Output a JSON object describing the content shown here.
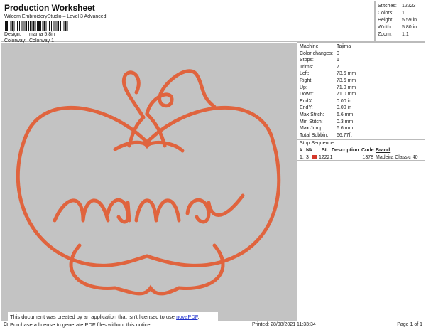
{
  "header": {
    "title": "Production Worksheet",
    "subtitle": "Wilcom EmbroideryStudio – Level 3 Advanced",
    "design_label": "Design:",
    "design_value": "mama 5.8in",
    "colorway_label": "Colorway:",
    "colorway_value": "Colorway 1"
  },
  "stats": [
    {
      "k": "Stitches:",
      "v": "12223"
    },
    {
      "k": "Colors:",
      "v": "1"
    },
    {
      "k": "Height:",
      "v": "5.59 in"
    },
    {
      "k": "Width:",
      "v": "5.80 in"
    },
    {
      "k": "Zoom:",
      "v": "1:1"
    }
  ],
  "machine": [
    {
      "k": "Machine:",
      "v": "Tajima"
    },
    {
      "k": "Color changes:",
      "v": "0"
    },
    {
      "k": "Stops:",
      "v": "1"
    },
    {
      "k": "Trims:",
      "v": "7"
    },
    {
      "k": "Left:",
      "v": "73.6 mm"
    },
    {
      "k": "Right:",
      "v": "73.6 mm"
    },
    {
      "k": "Up:",
      "v": "71.0 mm"
    },
    {
      "k": "Down:",
      "v": "71.0 mm"
    },
    {
      "k": "EndX:",
      "v": "0.00 in"
    },
    {
      "k": "EndY:",
      "v": "0.00 in"
    },
    {
      "k": "Max Stitch:",
      "v": "6.6 mm"
    },
    {
      "k": "Min Stitch:",
      "v": "0.3 mm"
    },
    {
      "k": "Max Jump:",
      "v": "6.6 mm"
    },
    {
      "k": "Total Bobbin:",
      "v": "66.77ft"
    }
  ],
  "stop_sequence": {
    "label": "Stop Sequence:",
    "headers": [
      "#",
      "N#",
      "St.",
      "Description",
      "Code",
      "Brand"
    ],
    "rows": [
      {
        "n": "1.",
        "nn": "3",
        "color": "#d4382a",
        "st": "12221",
        "desc": "",
        "code": "1378",
        "brand": "Madeira Classic 40"
      }
    ]
  },
  "design_color": "#e0643e",
  "footer": {
    "left": "Cr",
    "printed": "Printed: 28/08/2021 11:33:34",
    "page": "Page 1 of 1"
  },
  "notice": {
    "line1": "This document was created by an application that isn't licensed to use ",
    "link": "novaPDF",
    "line1_end": ".",
    "line2": "Purchase a license to generate PDF files without this notice."
  }
}
